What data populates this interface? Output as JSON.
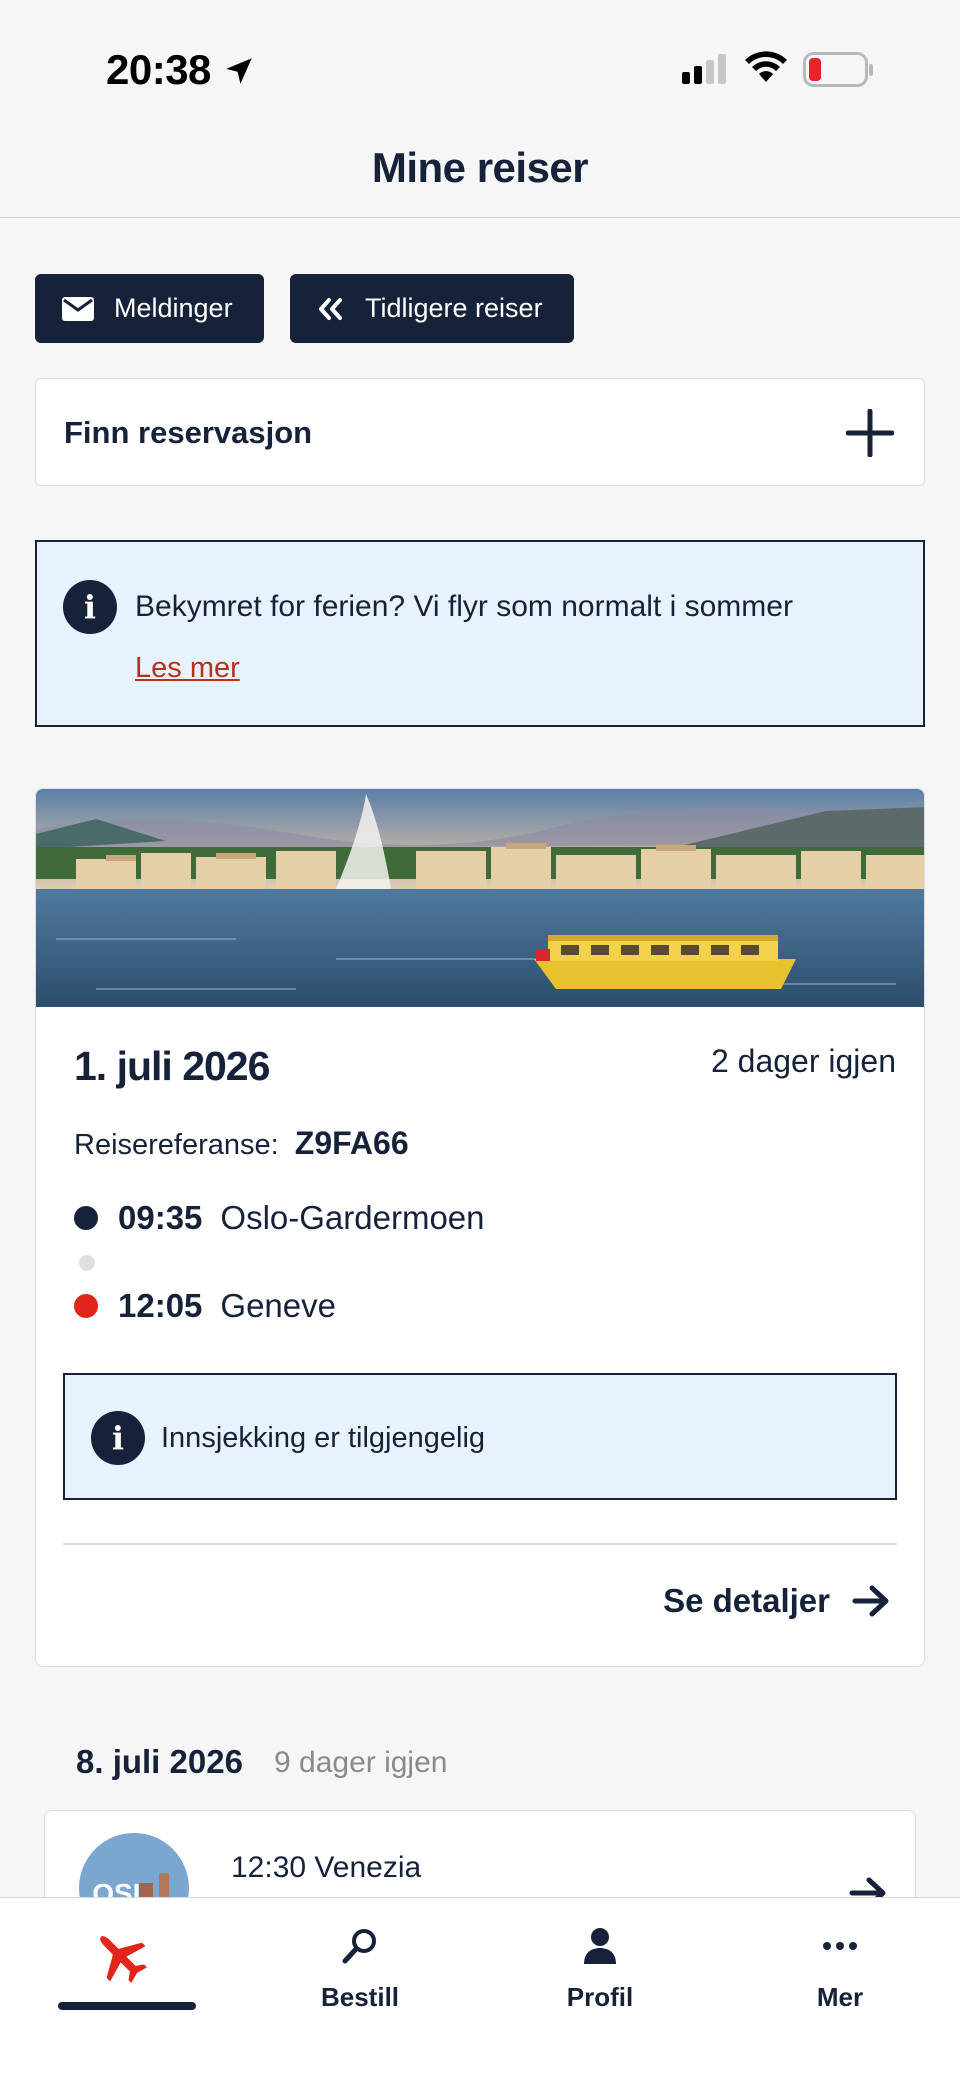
{
  "status_bar": {
    "time": "20:38",
    "icons": [
      "location-arrow-icon",
      "signal-icon",
      "wifi-icon",
      "battery-low-icon"
    ]
  },
  "header": {
    "title": "Mine reiser"
  },
  "actions": {
    "messages_label": "Meldinger",
    "previous_trips_label": "Tidligere reiser"
  },
  "find_reservation": {
    "label": "Finn reservasjon"
  },
  "alert": {
    "text": "Bekymret for ferien? Vi flyr som normalt i sommer",
    "link": "Les mer"
  },
  "trip": {
    "date": "1. juli 2026",
    "days_left": "2 dager igjen",
    "reference_label": "Reisereferanse:",
    "reference_code": "Z9FA66",
    "departure": {
      "time": "09:35",
      "place": "Oslo-Gardermoen"
    },
    "arrival": {
      "time": "12:05",
      "place": "Geneve"
    },
    "checkin_notice": "Innsjekking er tilgjengelig",
    "details_label": "Se detaljer"
  },
  "trip2": {
    "date": "8. juli 2026",
    "days_left": "9 dager igjen",
    "line": "12:30 Venezia",
    "avatar_text": "OSL"
  },
  "bottom_nav": {
    "items": [
      {
        "label": "",
        "icon": "plane-icon",
        "active": true
      },
      {
        "label": "Bestill",
        "icon": "search-icon",
        "active": false
      },
      {
        "label": "Profil",
        "icon": "person-icon",
        "active": false
      },
      {
        "label": "Mer",
        "icon": "more-icon",
        "active": false
      }
    ]
  },
  "colors": {
    "navy": "#16223a",
    "alert_bg": "#e8f2fd",
    "red": "#e1251b",
    "link_red": "#b5321c"
  }
}
